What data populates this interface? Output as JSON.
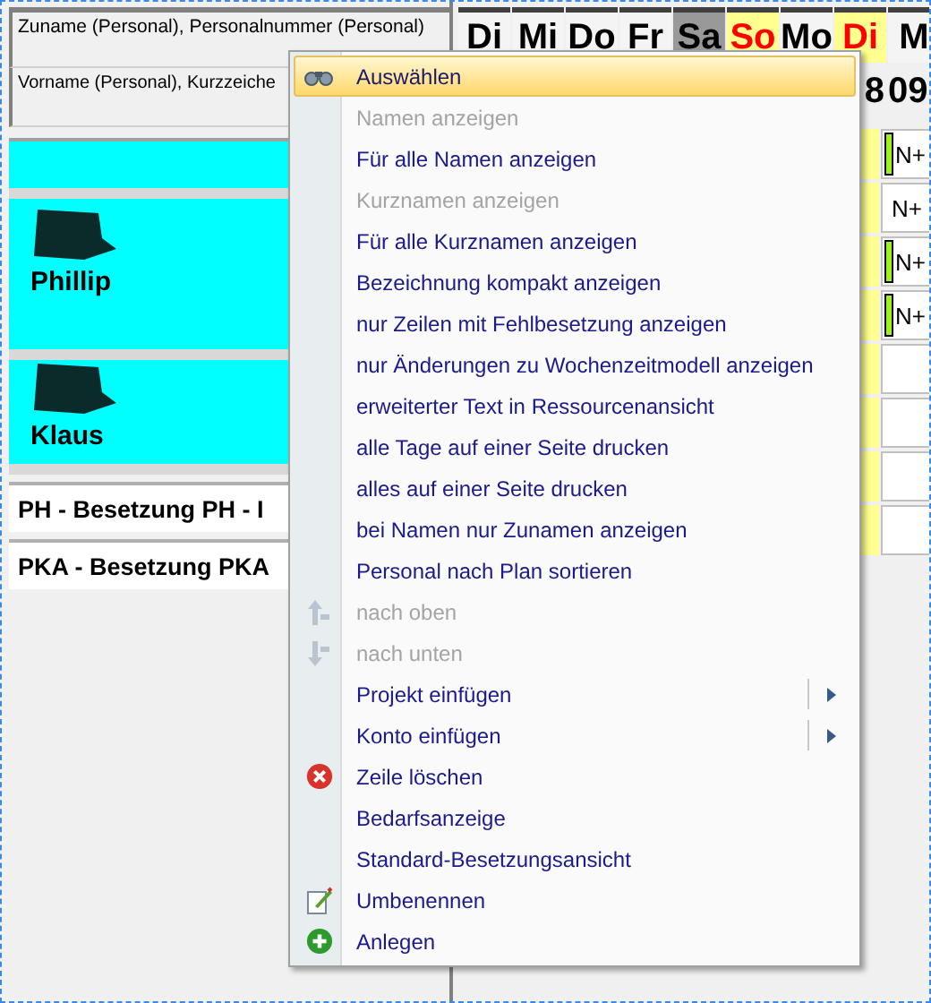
{
  "left_header": [
    "Zuname (Personal), Personalnummer (Personal)",
    "Vorname (Personal), Kurzzeiche"
  ],
  "people": [
    {
      "redacted": false
    },
    {
      "first_name": "Phillip",
      "redacted": true
    },
    {
      "first_name": "Klaus",
      "redacted": true
    }
  ],
  "groups": [
    "PH - Besetzung PH - I",
    "PKA - Besetzung PKA"
  ],
  "days": [
    {
      "label": "Di",
      "weekend": false,
      "holiday": false
    },
    {
      "label": "Mi",
      "weekend": false,
      "holiday": false
    },
    {
      "label": "Do",
      "weekend": false,
      "holiday": false
    },
    {
      "label": "Fr",
      "weekend": false,
      "holiday": false
    },
    {
      "label": "Sa",
      "weekend": true,
      "holiday": false
    },
    {
      "label": "So",
      "weekend": false,
      "holiday": true
    },
    {
      "label": "Mo",
      "weekend": false,
      "holiday": false
    },
    {
      "label": "Di",
      "weekend": false,
      "holiday": true
    },
    {
      "label": "M",
      "weekend": false,
      "holiday": false
    }
  ],
  "dates": [
    "8",
    "09"
  ],
  "cells": [
    {
      "text": "N+",
      "marked": true
    },
    {
      "text": "N+",
      "marked": false
    },
    {
      "text": "N+",
      "marked": true
    },
    {
      "text": "N+",
      "marked": true
    },
    {
      "marked": false
    },
    {
      "marked": false
    },
    {
      "marked": false
    },
    {
      "marked": false
    }
  ],
  "menu": [
    {
      "label": "Auswählen",
      "disabled": false,
      "selected": true,
      "submenu": false
    },
    {
      "label": "Namen anzeigen",
      "disabled": true,
      "selected": false,
      "submenu": false
    },
    {
      "label": "Für alle Namen anzeigen",
      "disabled": false,
      "selected": false,
      "submenu": false
    },
    {
      "label": "Kurznamen anzeigen",
      "disabled": true,
      "selected": false,
      "submenu": false
    },
    {
      "label": "Für alle Kurznamen anzeigen",
      "disabled": false,
      "selected": false,
      "submenu": false
    },
    {
      "label": "Bezeichnung kompakt anzeigen",
      "disabled": false,
      "selected": false,
      "submenu": false
    },
    {
      "label": "nur Zeilen mit Fehlbesetzung anzeigen",
      "disabled": false,
      "selected": false,
      "submenu": false
    },
    {
      "label": "nur Änderungen zu Wochenzeitmodell anzeigen",
      "disabled": false,
      "selected": false,
      "submenu": false
    },
    {
      "label": "erweiterter Text in Ressourcenansicht",
      "disabled": false,
      "selected": false,
      "submenu": false
    },
    {
      "label": "alle Tage auf einer Seite drucken",
      "disabled": false,
      "selected": false,
      "submenu": false
    },
    {
      "label": "alles auf einer Seite drucken",
      "disabled": false,
      "selected": false,
      "submenu": false
    },
    {
      "label": "bei Namen nur Zunamen anzeigen",
      "disabled": false,
      "selected": false,
      "submenu": false
    },
    {
      "label": "Personal nach Plan sortieren",
      "disabled": false,
      "selected": false,
      "submenu": false
    },
    {
      "label": "nach oben",
      "disabled": true,
      "selected": false,
      "submenu": false
    },
    {
      "label": "nach unten",
      "disabled": true,
      "selected": false,
      "submenu": false
    },
    {
      "label": "Projekt einfügen",
      "disabled": false,
      "selected": false,
      "submenu": true
    },
    {
      "label": "Konto einfügen",
      "disabled": false,
      "selected": false,
      "submenu": true
    },
    {
      "label": "Zeile löschen",
      "disabled": false,
      "selected": false,
      "submenu": false
    },
    {
      "label": "Bedarfsanzeige",
      "disabled": false,
      "selected": false,
      "submenu": false
    },
    {
      "label": "Standard-Besetzungsansicht",
      "disabled": false,
      "selected": false,
      "submenu": false
    },
    {
      "label": "Umbenennen",
      "disabled": false,
      "selected": false,
      "submenu": false
    },
    {
      "label": "Anlegen",
      "disabled": false,
      "selected": false,
      "submenu": false
    }
  ]
}
